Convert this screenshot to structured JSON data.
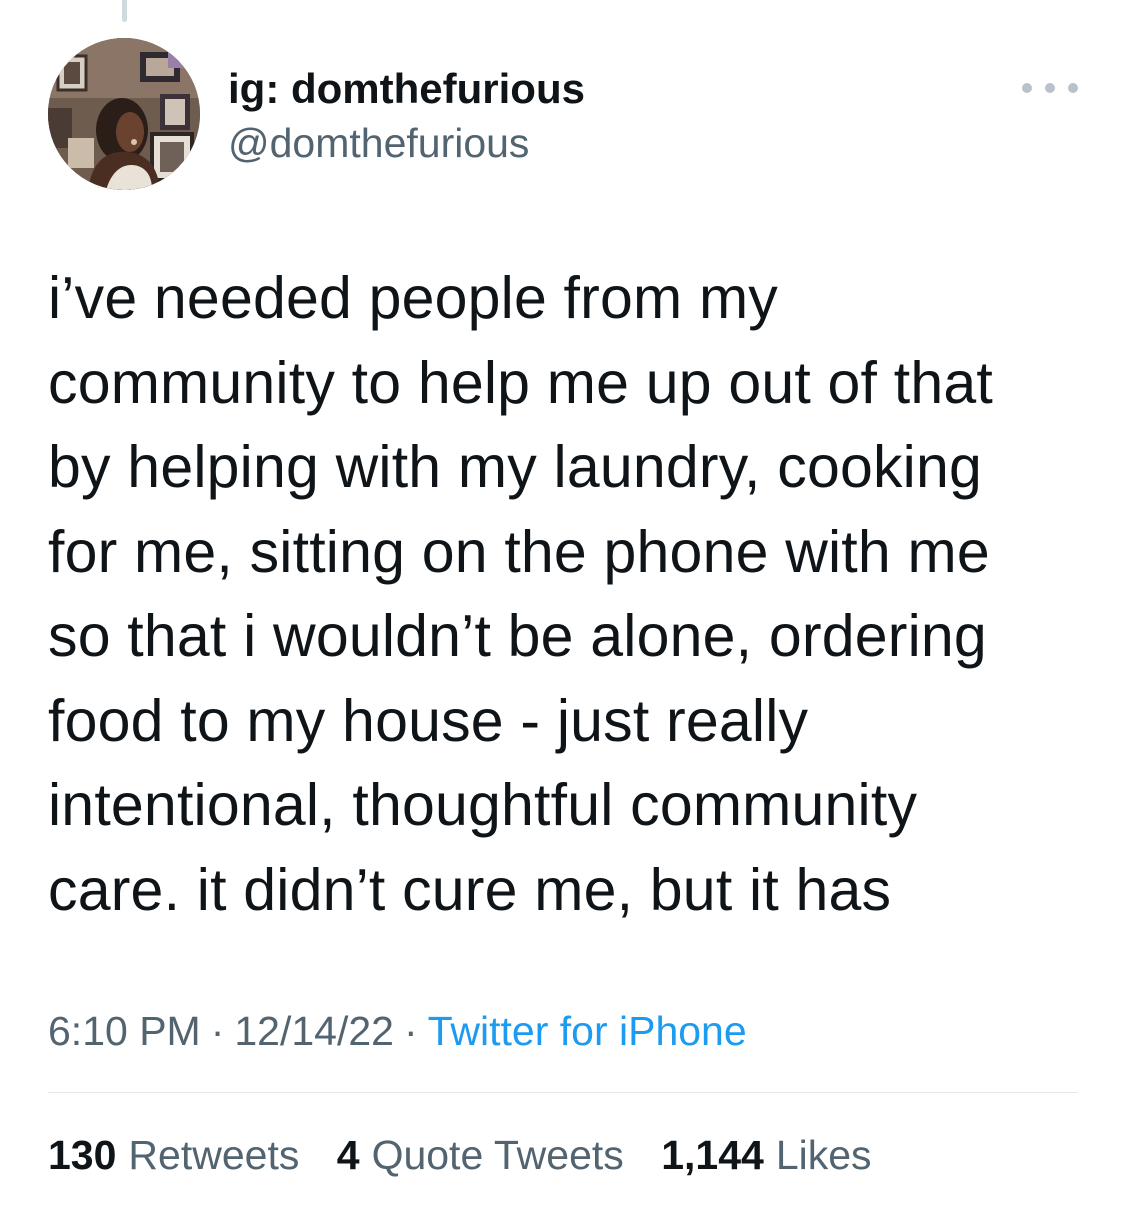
{
  "tweet": {
    "author": {
      "display_name": "ig: domthefurious",
      "handle": "@domthefurious"
    },
    "more_icon": "more-horizontal-icon",
    "text_lines": [
      "i’ve needed people from my",
      "community to help me up out of that",
      "by helping with my laundry, cooking",
      "for me, sitting on the phone with me",
      "so that i wouldn’t be alone, ordering",
      "food to my house - just really",
      "intentional, thoughtful community",
      "care. it didn’t cure me, but it has"
    ],
    "meta": {
      "time": "6:10 PM",
      "separator": "·",
      "date": "12/14/22",
      "source": "Twitter for iPhone"
    },
    "stats": {
      "retweets_count": "130",
      "retweets_label": "Retweets",
      "quotes_count": "4",
      "quotes_label": "Quote Tweets",
      "likes_count": "1,144",
      "likes_label": "Likes"
    }
  },
  "colors": {
    "text": "#0f1419",
    "secondary": "#536471",
    "link": "#1d9bf0",
    "divider": "#e3e8eb"
  }
}
